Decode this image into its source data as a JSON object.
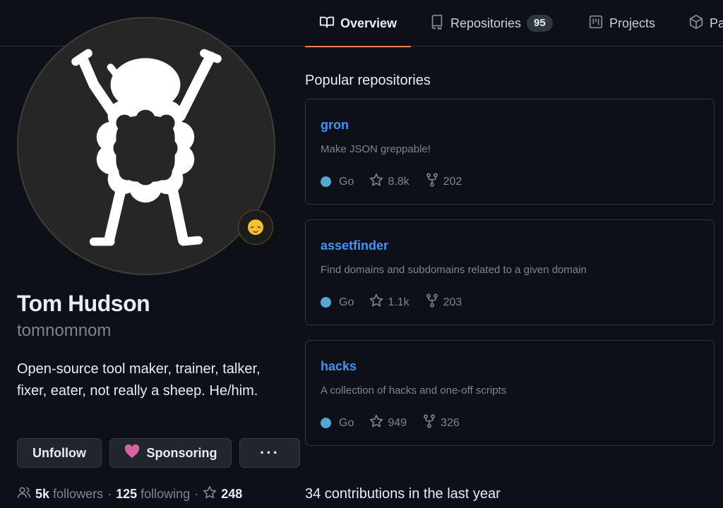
{
  "nav": {
    "tabs": [
      {
        "label": "Overview",
        "icon": "book-icon",
        "active": true
      },
      {
        "label": "Repositories",
        "icon": "repo-icon",
        "count": "95"
      },
      {
        "label": "Projects",
        "icon": "project-board-icon"
      },
      {
        "label": "Pa",
        "icon": "package-icon"
      }
    ]
  },
  "profile": {
    "full_name": "Tom Hudson",
    "username": "tomnomnom",
    "bio": "Open-source tool maker, trainer, talker, fixer, eater, not really a sheep. He/him.",
    "status_emoji": "relieved-face-emoji",
    "buttons": {
      "unfollow": "Unfollow",
      "sponsoring": "Sponsoring",
      "more": "···"
    },
    "followers_count": "5k",
    "followers_label": "followers",
    "following_count": "125",
    "following_label": "following",
    "stars_count": "248"
  },
  "popular": {
    "title": "Popular repositories",
    "repos": [
      {
        "name": "gron",
        "description": "Make JSON greppable!",
        "language": "Go",
        "language_color": "#58a6d6",
        "stars": "8.8k",
        "forks": "202"
      },
      {
        "name": "assetfinder",
        "description": "Find domains and subdomains related to a given domain",
        "language": "Go",
        "language_color": "#58a6d6",
        "stars": "1.1k",
        "forks": "203"
      },
      {
        "name": "hacks",
        "description": "A collection of hacks and one-off scripts",
        "language": "Go",
        "language_color": "#58a6d6",
        "stars": "949",
        "forks": "326"
      }
    ]
  },
  "contributions": {
    "title": "34 contributions in the last year"
  },
  "colors": {
    "accent_link": "#4493f8",
    "tab_underline": "#f78166",
    "background": "#0d1117",
    "sponsor_heart": "#db61a2"
  }
}
